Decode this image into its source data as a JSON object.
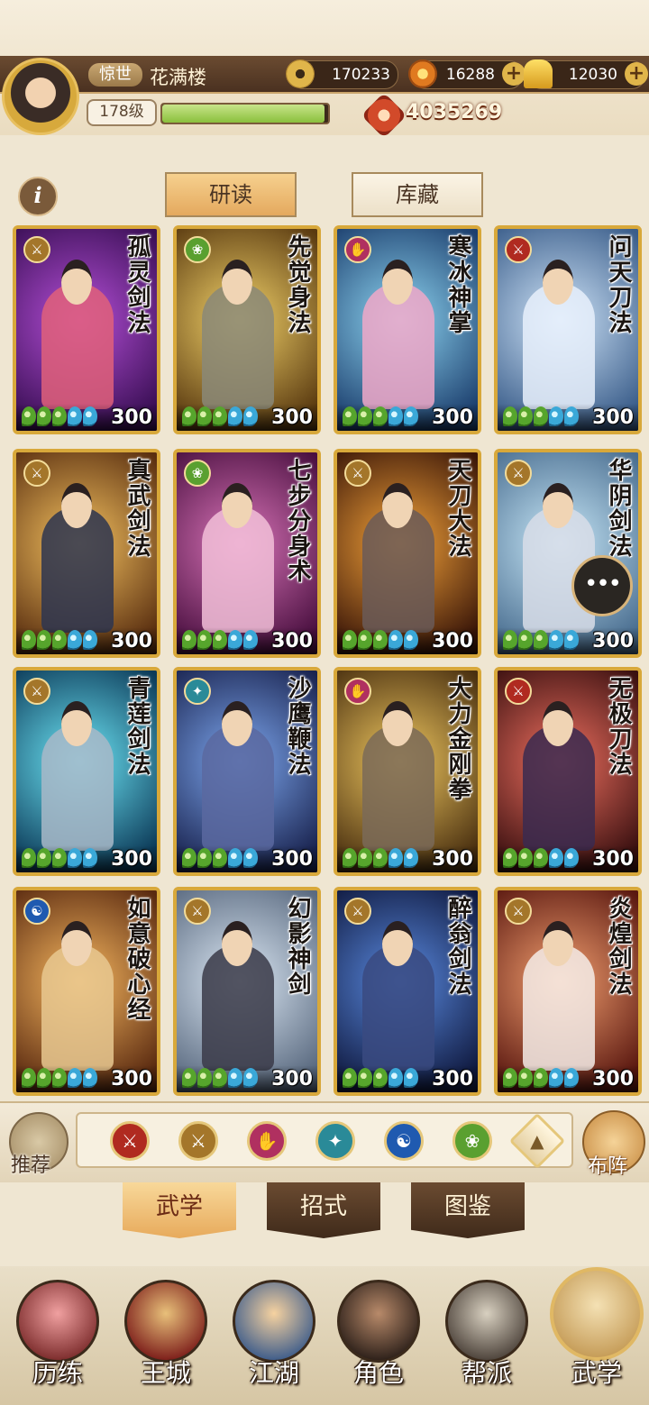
{
  "player": {
    "title_badge": "惊世",
    "name": "花满楼",
    "level": "178级",
    "xp_fraction": 0.98,
    "power": "4035269"
  },
  "resources": {
    "coins": "170233",
    "gems": "16288",
    "ingots": "12030",
    "add_icon": "plus-icon"
  },
  "tabs": {
    "info": "i",
    "study": "研读",
    "collection": "库藏"
  },
  "cards": [
    {
      "name": "孤灵剑法",
      "school": "sword",
      "pips": [
        "g",
        "g",
        "g",
        "b",
        "b"
      ],
      "value": "300",
      "bg": [
        "#b54fd8",
        "#3a0f55"
      ],
      "figure": "#e0607a"
    },
    {
      "name": "先觉身法",
      "school": "leaf",
      "pips": [
        "g",
        "g",
        "g",
        "b",
        "b"
      ],
      "value": "300",
      "bg": [
        "#f3d36a",
        "#5a3a10"
      ],
      "figure": "#8a8878"
    },
    {
      "name": "寒冰神掌",
      "school": "palm",
      "pips": [
        "g",
        "g",
        "g",
        "b",
        "b"
      ],
      "value": "300",
      "bg": [
        "#8fd6f2",
        "#1c3f6e"
      ],
      "figure": "#f0a8c8"
    },
    {
      "name": "问天刀法",
      "school": "blade",
      "pips": [
        "g",
        "g",
        "g",
        "b",
        "b"
      ],
      "value": "300",
      "bg": [
        "#cfe4f8",
        "#3a5d8a"
      ],
      "figure": "#e8f0fb"
    },
    {
      "name": "真武剑法",
      "school": "sword",
      "pips": [
        "g",
        "g",
        "g",
        "b",
        "b"
      ],
      "value": "300",
      "bg": [
        "#f5c260",
        "#5a2f10"
      ],
      "figure": "#2d3550"
    },
    {
      "name": "七步分身术",
      "school": "leaf",
      "pips": [
        "g",
        "g",
        "g",
        "b",
        "b"
      ],
      "value": "300",
      "bg": [
        "#d974b8",
        "#4a1040"
      ],
      "figure": "#f2c0d8"
    },
    {
      "name": "天刀大法",
      "school": "sword",
      "pips": [
        "g",
        "g",
        "g",
        "b",
        "b"
      ],
      "value": "300",
      "bg": [
        "#f6a43a",
        "#3a1608"
      ],
      "figure": "#6a5a58"
    },
    {
      "name": "华阴剑法",
      "school": "sword",
      "pips": [
        "g",
        "g",
        "g",
        "b",
        "b"
      ],
      "value": "300",
      "bg": [
        "#c8e8f8",
        "#4a6e90"
      ],
      "figure": "#d8dde8"
    },
    {
      "name": "青莲剑法",
      "school": "sword",
      "pips": [
        "g",
        "g",
        "g",
        "b",
        "b"
      ],
      "value": "300",
      "bg": [
        "#6ee8f8",
        "#0c3a58"
      ],
      "figure": "#a8b8c8"
    },
    {
      "name": "沙鹰鞭法",
      "school": "fan",
      "pips": [
        "g",
        "g",
        "g",
        "b",
        "b"
      ],
      "value": "300",
      "bg": [
        "#7ea8f0",
        "#1a2450"
      ],
      "figure": "#5a68a0"
    },
    {
      "name": "大力金刚拳",
      "school": "palm",
      "pips": [
        "g",
        "g",
        "g",
        "b",
        "b"
      ],
      "value": "300",
      "bg": [
        "#f0c860",
        "#4a3010"
      ],
      "figure": "#7a6a58"
    },
    {
      "name": "无极刀法",
      "school": "blade",
      "pips": [
        "g",
        "g",
        "g",
        "b",
        "b"
      ],
      "value": "300",
      "bg": [
        "#f07060",
        "#3a1010"
      ],
      "figure": "#3a2a50"
    },
    {
      "name": "如意破心经",
      "school": "yinyang",
      "pips": [
        "g",
        "g",
        "g",
        "b",
        "b"
      ],
      "value": "300",
      "bg": [
        "#f8b860",
        "#5a2a10"
      ],
      "figure": "#e8c890"
    },
    {
      "name": "幻影神剑",
      "school": "sword",
      "pips": [
        "g",
        "g",
        "g",
        "b",
        "b"
      ],
      "value": "300",
      "bg": [
        "#dce8f4",
        "#5a6a80"
      ],
      "figure": "#3a3a48"
    },
    {
      "name": "醉翁剑法",
      "school": "sword",
      "pips": [
        "g",
        "g",
        "g",
        "b",
        "b"
      ],
      "value": "300",
      "bg": [
        "#5a8ae0",
        "#101a40"
      ],
      "figure": "#3a4a80"
    },
    {
      "name": "炎煌剑法",
      "school": "sword",
      "pips": [
        "g",
        "g",
        "g",
        "b",
        "b"
      ],
      "value": "300",
      "bg": [
        "#f4a070",
        "#5a1810"
      ],
      "figure": "#f4ece8"
    }
  ],
  "school_icons": {
    "sword": {
      "icon": "sword-school-icon",
      "color": "#a4762a",
      "glyph": "⚔"
    },
    "leaf": {
      "icon": "leaf-school-icon",
      "color": "#5aa030",
      "glyph": "❀"
    },
    "palm": {
      "icon": "palm-school-icon",
      "color": "#b03060",
      "glyph": "✋"
    },
    "blade": {
      "icon": "blade-school-icon",
      "color": "#b02a20",
      "glyph": "⚔"
    },
    "fan": {
      "icon": "fan-school-icon",
      "color": "#2a8a98",
      "glyph": "✦"
    },
    "yinyang": {
      "icon": "yinyang-school-icon",
      "color": "#1f5ab0",
      "glyph": "☯"
    }
  },
  "chat": {
    "glyph": "•••"
  },
  "filters": {
    "recommend_label": "推荐",
    "formation_label": "布阵",
    "icons": [
      {
        "name": "blade-filter-icon",
        "color": "#b02a20",
        "glyph": "⚔",
        "shape": "circle"
      },
      {
        "name": "sword-filter-icon",
        "color": "#a4762a",
        "glyph": "⚔",
        "shape": "circle"
      },
      {
        "name": "palm-filter-icon",
        "color": "#b03060",
        "glyph": "✋",
        "shape": "circle"
      },
      {
        "name": "fan-filter-icon",
        "color": "#2a8a98",
        "glyph": "✦",
        "shape": "circle"
      },
      {
        "name": "yinyang-filter-icon",
        "color": "#1f5ab0",
        "glyph": "☯",
        "shape": "circle"
      },
      {
        "name": "leaf-filter-icon",
        "color": "#5aa030",
        "glyph": "❀",
        "shape": "circle"
      },
      {
        "name": "diamond-filter-icon",
        "color": "#f0e0b8",
        "glyph": "▲",
        "shape": "diamond"
      }
    ]
  },
  "subtabs": {
    "wuxue": "武学",
    "zhaoshi": "招式",
    "tujian": "图鉴"
  },
  "nav": [
    {
      "id": "lilian",
      "label": "历练",
      "icon": "training-icon",
      "bg": [
        "#f0a0a0",
        "#7a2a2a"
      ]
    },
    {
      "id": "wangcheng",
      "label": "王城",
      "icon": "city-icon",
      "bg": [
        "#e8c07a",
        "#7a1a18"
      ]
    },
    {
      "id": "jianghu",
      "label": "江湖",
      "icon": "jianghu-icon",
      "bg": [
        "#f6d2a0",
        "#3a5a8a"
      ]
    },
    {
      "id": "jiaose",
      "label": "角色",
      "icon": "character-icon",
      "bg": [
        "#b88a6a",
        "#2a1e18"
      ]
    },
    {
      "id": "bangpai",
      "label": "帮派",
      "icon": "guild-icon",
      "bg": [
        "#d8d0c0",
        "#4a4038"
      ]
    },
    {
      "id": "wuxue",
      "label": "武学",
      "icon": "scroll-icon",
      "bg": [
        "#f4e1b4",
        "#c49a55"
      ]
    }
  ]
}
